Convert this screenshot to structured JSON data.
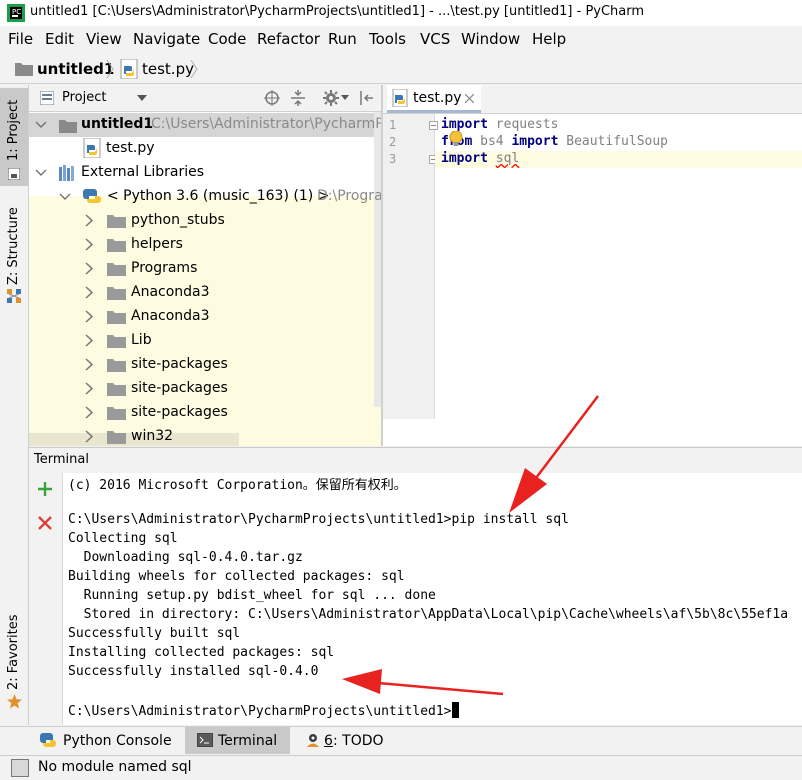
{
  "window": {
    "title": "untitled1 [C:\\Users\\Administrator\\PycharmProjects\\untitled1] - ...\\test.py [untitled1] - PyCharm"
  },
  "menu": [
    "File",
    "Edit",
    "View",
    "Navigate",
    "Code",
    "Refactor",
    "Run",
    "Tools",
    "VCS",
    "Window",
    "Help"
  ],
  "breadcrumb": {
    "project": "untitled1",
    "file": "test.py"
  },
  "side_tabs": {
    "project": "1: Project",
    "structure": "Z: Structure",
    "favorites": "2: Favorites"
  },
  "project_panel": {
    "view_mode": "Project",
    "root": {
      "name": "untitled1",
      "path": "C:\\Users\\Administrator\\PycharmPr"
    },
    "file": "test.py",
    "external_libraries": "External Libraries",
    "interpreter": {
      "name": "< Python 3.6 (music_163) (1) >",
      "path": "D:\\Progra"
    },
    "folders": [
      "python_stubs",
      "helpers",
      "Programs",
      "Anaconda3",
      "Anaconda3",
      "Lib",
      "site-packages",
      "site-packages",
      "site-packages",
      "win32"
    ]
  },
  "editor": {
    "tab": "test.py",
    "line_numbers": [
      "1",
      "2",
      "3"
    ],
    "lines": [
      {
        "kw1": "import",
        "rest1": " requests"
      },
      {
        "kw1": "from",
        "rest1": " bs4 ",
        "kw2": "import",
        "rest2": " BeautifulSoup"
      },
      {
        "kw1": "import",
        "rest1": " ",
        "err": "sql"
      }
    ]
  },
  "terminal": {
    "title": "Terminal",
    "lines": [
      "(c) 2016 Microsoft Corporation。保留所有权利。",
      "",
      "C:\\Users\\Administrator\\PycharmProjects\\untitled1>pip install sql",
      "Collecting sql",
      "  Downloading sql-0.4.0.tar.gz",
      "Building wheels for collected packages: sql",
      "  Running setup.py bdist_wheel for sql ... done",
      "  Stored in directory: C:\\Users\\Administrator\\AppData\\Local\\pip\\Cache\\wheels\\af\\5b\\8c\\55ef1a",
      "Successfully built sql",
      "Installing collected packages: sql",
      "Successfully installed sql-0.4.0",
      "",
      "C:\\Users\\Administrator\\PycharmProjects\\untitled1>"
    ]
  },
  "bottom_tabs": [
    {
      "label": "Python Console",
      "icon": "python-icon"
    },
    {
      "label": "Terminal",
      "icon": "terminal-icon",
      "active": true
    },
    {
      "mnemonic": "6",
      "label": ": TODO",
      "icon": "todo-icon"
    }
  ],
  "status": "No module named sql",
  "colors": {
    "keyword": "#000080",
    "error_underline": "#ff0000",
    "annotation_arrow": "#e8231f",
    "tree_highlight": "#fdfbe0"
  }
}
